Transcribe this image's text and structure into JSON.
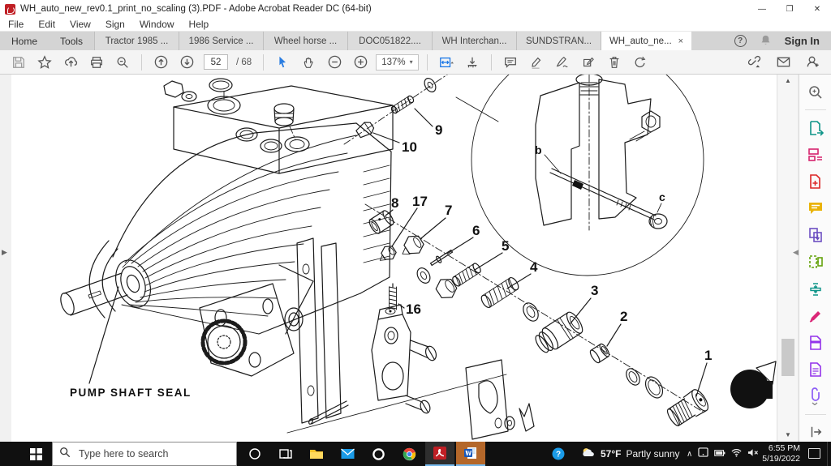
{
  "window": {
    "title": "WH_auto_new_rev0.1_print_no_scaling (3).PDF - Adobe Acrobat Reader DC (64-bit)",
    "minimize": "—",
    "maximize": "❐",
    "close": "✕"
  },
  "menu": {
    "items": [
      "File",
      "Edit",
      "View",
      "Sign",
      "Window",
      "Help"
    ]
  },
  "tabbar": {
    "home": "Home",
    "tools": "Tools",
    "doc_tabs": [
      "Tractor 1985 ...",
      "1986 Service ...",
      "Wheel horse ...",
      "DOC051822....",
      "WH Interchan...",
      "SUNDSTRAN..."
    ],
    "active_tab": "WH_auto_ne...",
    "active_close": "×",
    "help_glyph": "?",
    "sign_in": "Sign In"
  },
  "toolbar": {
    "page_current": "52",
    "page_sep": "/",
    "page_total": "68",
    "zoom_level": "137%"
  },
  "icons": {
    "zoom_caret": "▾",
    "scroll_up_glyph": "▲",
    "scroll_down_glyph": "▼",
    "nav_expand_glyph": "▶",
    "pane_collapse_glyph": "◀",
    "tray_chevron": "∧"
  },
  "document": {
    "seal_label": "PUMP SHAFT SEAL",
    "callouts": {
      "c1": "1",
      "c2": "2",
      "c3": "3",
      "c4": "4",
      "c5": "5",
      "c6": "6",
      "c7": "7",
      "c8": "8",
      "c9": "9",
      "c10": "10",
      "c16": "16",
      "c17": "17",
      "b": "b",
      "c": "c"
    }
  },
  "taskbar": {
    "search_placeholder": "Type here to search",
    "weather": {
      "temp": "57°F",
      "desc": "Partly sunny"
    },
    "clock": {
      "time": "6:55 PM",
      "date": "5/19/2022"
    }
  },
  "colors": {
    "acrobat_red": "#c01f25",
    "accent_blue": "#1473e6",
    "taskbar_black": "#101010",
    "active_underline": "#76b9ed",
    "word_tile_orange": "#b4672a"
  }
}
